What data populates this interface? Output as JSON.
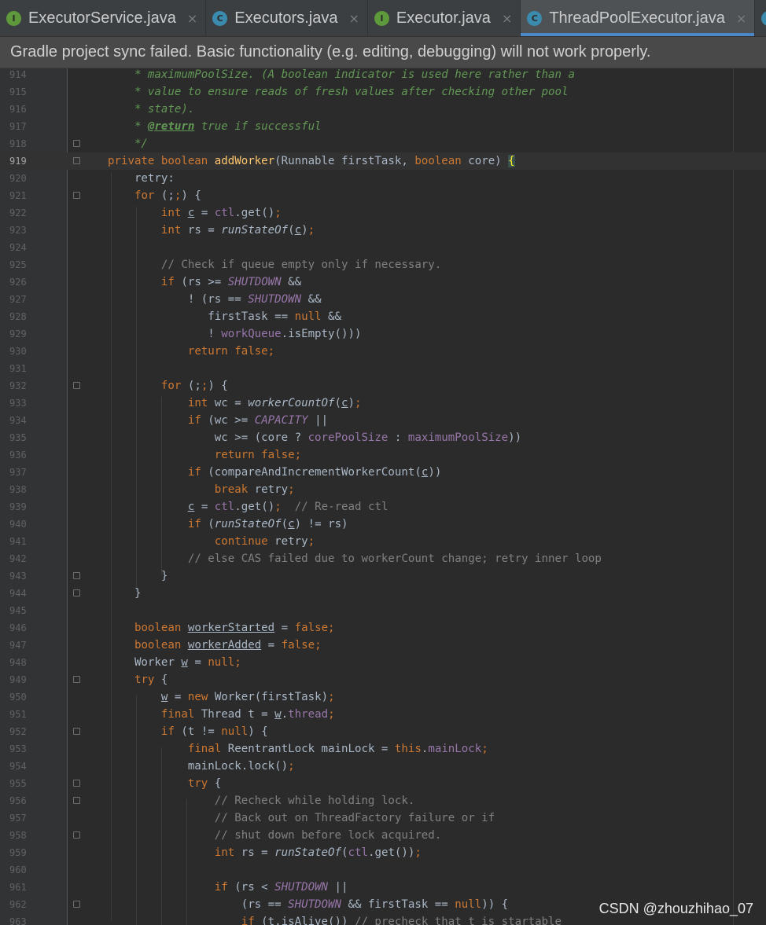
{
  "tabs": [
    {
      "label": "ExecutorService.java",
      "kind": "interface",
      "icon": "interface-icon",
      "icon_letter": "I",
      "close": "×",
      "active": false
    },
    {
      "label": "Executors.java",
      "kind": "class",
      "icon": "class-icon",
      "icon_letter": "C",
      "close": "×",
      "active": false
    },
    {
      "label": "Executor.java",
      "kind": "interface",
      "icon": "interface-icon",
      "icon_letter": "I",
      "close": "×",
      "active": false
    },
    {
      "label": "ThreadPoolExecutor.java",
      "kind": "class",
      "icon": "class-icon",
      "icon_letter": "C",
      "close": "×",
      "active": true
    },
    {
      "label": "At",
      "kind": "class",
      "icon": "class-icon",
      "icon_letter": "C",
      "close": "",
      "active": false
    }
  ],
  "banner": {
    "message": "Gradle project sync failed. Basic functionality (e.g. editing, debugging) will not work properly."
  },
  "editor": {
    "current_line": 919,
    "lines": [
      {
        "n": 914,
        "fold": false,
        "segs": [
          [
            "dc",
            "    * maximumPoolSize. (A boolean indicator is used here rather than a"
          ]
        ]
      },
      {
        "n": 915,
        "fold": false,
        "segs": [
          [
            "dc",
            "    * value to ensure reads of fresh values after checking other pool"
          ]
        ]
      },
      {
        "n": 916,
        "fold": false,
        "segs": [
          [
            "dc",
            "    * state)."
          ]
        ]
      },
      {
        "n": 917,
        "fold": false,
        "segs": [
          [
            "dc",
            "    * "
          ],
          [
            "tag",
            "@return"
          ],
          [
            "dc",
            " true if successful"
          ]
        ]
      },
      {
        "n": 918,
        "fold": true,
        "segs": [
          [
            "dc",
            "    */"
          ]
        ]
      },
      {
        "n": 919,
        "fold": true,
        "segs": [
          [
            "k",
            "private boolean "
          ],
          [
            "fn",
            "addWorker"
          ],
          [
            "p",
            "(Runnable firstTask, "
          ],
          [
            "k",
            "boolean "
          ],
          [
            "p",
            "core) "
          ],
          [
            "br",
            "{"
          ]
        ]
      },
      {
        "n": 920,
        "fold": false,
        "segs": [
          [
            "p",
            "    retry:"
          ]
        ]
      },
      {
        "n": 921,
        "fold": true,
        "segs": [
          [
            "p",
            "    "
          ],
          [
            "k",
            "for "
          ],
          [
            "p",
            "(;"
          ],
          [
            "k",
            ";"
          ],
          [
            "p",
            ") {"
          ]
        ]
      },
      {
        "n": 922,
        "fold": false,
        "segs": [
          [
            "p",
            "        "
          ],
          [
            "k",
            "int "
          ],
          [
            "u",
            "c"
          ],
          [
            "p",
            " = "
          ],
          [
            "fi",
            "ctl"
          ],
          [
            "p",
            ".get()"
          ],
          [
            "k",
            ";"
          ]
        ]
      },
      {
        "n": 923,
        "fold": false,
        "segs": [
          [
            "p",
            "        "
          ],
          [
            "k",
            "int "
          ],
          [
            "p",
            "rs = "
          ],
          [
            "sm",
            "runStateOf"
          ],
          [
            "p",
            "("
          ],
          [
            "u",
            "c"
          ],
          [
            "p",
            ")"
          ],
          [
            "k",
            ";"
          ]
        ]
      },
      {
        "n": 924,
        "fold": false,
        "segs": []
      },
      {
        "n": 925,
        "fold": false,
        "segs": [
          [
            "p",
            "        "
          ],
          [
            "cm",
            "// Check if queue empty only if necessary."
          ]
        ]
      },
      {
        "n": 926,
        "fold": false,
        "segs": [
          [
            "p",
            "        "
          ],
          [
            "k",
            "if "
          ],
          [
            "p",
            "(rs >= "
          ],
          [
            "st",
            "SHUTDOWN"
          ],
          [
            "p",
            " &&"
          ]
        ]
      },
      {
        "n": 927,
        "fold": false,
        "segs": [
          [
            "p",
            "            ! (rs == "
          ],
          [
            "st",
            "SHUTDOWN"
          ],
          [
            "p",
            " &&"
          ]
        ]
      },
      {
        "n": 928,
        "fold": false,
        "segs": [
          [
            "p",
            "               firstTask == "
          ],
          [
            "k",
            "null "
          ],
          [
            "p",
            "&&"
          ]
        ]
      },
      {
        "n": 929,
        "fold": false,
        "segs": [
          [
            "p",
            "               ! "
          ],
          [
            "fi",
            "workQueue"
          ],
          [
            "p",
            ".isEmpty()))"
          ]
        ]
      },
      {
        "n": 930,
        "fold": false,
        "segs": [
          [
            "p",
            "            "
          ],
          [
            "k",
            "return false;"
          ]
        ]
      },
      {
        "n": 931,
        "fold": false,
        "segs": []
      },
      {
        "n": 932,
        "fold": true,
        "segs": [
          [
            "p",
            "        "
          ],
          [
            "k",
            "for "
          ],
          [
            "p",
            "(;"
          ],
          [
            "k",
            ";"
          ],
          [
            "p",
            ") {"
          ]
        ]
      },
      {
        "n": 933,
        "fold": false,
        "segs": [
          [
            "p",
            "            "
          ],
          [
            "k",
            "int "
          ],
          [
            "p",
            "wc = "
          ],
          [
            "sm",
            "workerCountOf"
          ],
          [
            "p",
            "("
          ],
          [
            "u",
            "c"
          ],
          [
            "p",
            ")"
          ],
          [
            "k",
            ";"
          ]
        ]
      },
      {
        "n": 934,
        "fold": false,
        "segs": [
          [
            "p",
            "            "
          ],
          [
            "k",
            "if "
          ],
          [
            "p",
            "(wc >= "
          ],
          [
            "st",
            "CAPACITY"
          ],
          [
            "p",
            " ||"
          ]
        ]
      },
      {
        "n": 935,
        "fold": false,
        "segs": [
          [
            "p",
            "                wc >= (core ? "
          ],
          [
            "fi",
            "corePoolSize"
          ],
          [
            "p",
            " : "
          ],
          [
            "fi",
            "maximumPoolSize"
          ],
          [
            "p",
            "))"
          ]
        ]
      },
      {
        "n": 936,
        "fold": false,
        "segs": [
          [
            "p",
            "                "
          ],
          [
            "k",
            "return false;"
          ]
        ]
      },
      {
        "n": 937,
        "fold": false,
        "segs": [
          [
            "p",
            "            "
          ],
          [
            "k",
            "if "
          ],
          [
            "p",
            "(compareAndIncrementWorkerCount("
          ],
          [
            "u",
            "c"
          ],
          [
            "p",
            "))"
          ]
        ]
      },
      {
        "n": 938,
        "fold": false,
        "segs": [
          [
            "p",
            "                "
          ],
          [
            "k",
            "break "
          ],
          [
            "p",
            "retry"
          ],
          [
            "k",
            ";"
          ]
        ]
      },
      {
        "n": 939,
        "fold": false,
        "segs": [
          [
            "p",
            "            "
          ],
          [
            "u",
            "c"
          ],
          [
            "p",
            " = "
          ],
          [
            "fi",
            "ctl"
          ],
          [
            "p",
            ".get()"
          ],
          [
            "k",
            ";  "
          ],
          [
            "cm",
            "// Re-read ctl"
          ]
        ]
      },
      {
        "n": 940,
        "fold": false,
        "segs": [
          [
            "p",
            "            "
          ],
          [
            "k",
            "if "
          ],
          [
            "p",
            "("
          ],
          [
            "sm",
            "runStateOf"
          ],
          [
            "p",
            "("
          ],
          [
            "u",
            "c"
          ],
          [
            "p",
            ") != rs)"
          ]
        ]
      },
      {
        "n": 941,
        "fold": false,
        "segs": [
          [
            "p",
            "                "
          ],
          [
            "k",
            "continue "
          ],
          [
            "p",
            "retry"
          ],
          [
            "k",
            ";"
          ]
        ]
      },
      {
        "n": 942,
        "fold": false,
        "segs": [
          [
            "p",
            "            "
          ],
          [
            "cm",
            "// else CAS failed due to workerCount change; retry inner loop"
          ]
        ]
      },
      {
        "n": 943,
        "fold": true,
        "segs": [
          [
            "p",
            "        }"
          ]
        ]
      },
      {
        "n": 944,
        "fold": true,
        "segs": [
          [
            "p",
            "    }"
          ]
        ]
      },
      {
        "n": 945,
        "fold": false,
        "segs": []
      },
      {
        "n": 946,
        "fold": false,
        "segs": [
          [
            "p",
            "    "
          ],
          [
            "k",
            "boolean "
          ],
          [
            "u",
            "workerStarted"
          ],
          [
            "p",
            " = "
          ],
          [
            "k",
            "false;"
          ]
        ]
      },
      {
        "n": 947,
        "fold": false,
        "segs": [
          [
            "p",
            "    "
          ],
          [
            "k",
            "boolean "
          ],
          [
            "u",
            "workerAdded"
          ],
          [
            "p",
            " = "
          ],
          [
            "k",
            "false;"
          ]
        ]
      },
      {
        "n": 948,
        "fold": false,
        "segs": [
          [
            "p",
            "    Worker "
          ],
          [
            "u",
            "w"
          ],
          [
            "p",
            " = "
          ],
          [
            "k",
            "null;"
          ]
        ]
      },
      {
        "n": 949,
        "fold": true,
        "segs": [
          [
            "p",
            "    "
          ],
          [
            "k",
            "try "
          ],
          [
            "p",
            "{"
          ]
        ]
      },
      {
        "n": 950,
        "fold": false,
        "segs": [
          [
            "p",
            "        "
          ],
          [
            "u",
            "w"
          ],
          [
            "p",
            " = "
          ],
          [
            "k",
            "new "
          ],
          [
            "p",
            "Worker(firstTask)"
          ],
          [
            "k",
            ";"
          ]
        ]
      },
      {
        "n": 951,
        "fold": false,
        "segs": [
          [
            "p",
            "        "
          ],
          [
            "k",
            "final "
          ],
          [
            "p",
            "Thread t = "
          ],
          [
            "u",
            "w"
          ],
          [
            "p",
            "."
          ],
          [
            "fi",
            "thread"
          ],
          [
            "k",
            ";"
          ]
        ]
      },
      {
        "n": 952,
        "fold": true,
        "segs": [
          [
            "p",
            "        "
          ],
          [
            "k",
            "if "
          ],
          [
            "p",
            "(t != "
          ],
          [
            "k",
            "null"
          ],
          [
            "p",
            ") {"
          ]
        ]
      },
      {
        "n": 953,
        "fold": false,
        "segs": [
          [
            "p",
            "            "
          ],
          [
            "k",
            "final "
          ],
          [
            "p",
            "ReentrantLock mainLock = "
          ],
          [
            "k",
            "this"
          ],
          [
            "p",
            "."
          ],
          [
            "fi",
            "mainLock"
          ],
          [
            "k",
            ";"
          ]
        ]
      },
      {
        "n": 954,
        "fold": false,
        "segs": [
          [
            "p",
            "            mainLock.lock()"
          ],
          [
            "k",
            ";"
          ]
        ]
      },
      {
        "n": 955,
        "fold": true,
        "segs": [
          [
            "p",
            "            "
          ],
          [
            "k",
            "try "
          ],
          [
            "p",
            "{"
          ]
        ]
      },
      {
        "n": 956,
        "fold": true,
        "segs": [
          [
            "p",
            "                "
          ],
          [
            "cm",
            "// Recheck while holding lock."
          ]
        ]
      },
      {
        "n": 957,
        "fold": false,
        "segs": [
          [
            "p",
            "                "
          ],
          [
            "cm",
            "// Back out on ThreadFactory failure or if"
          ]
        ]
      },
      {
        "n": 958,
        "fold": true,
        "segs": [
          [
            "p",
            "                "
          ],
          [
            "cm",
            "// shut down before lock acquired."
          ]
        ]
      },
      {
        "n": 959,
        "fold": false,
        "segs": [
          [
            "p",
            "                "
          ],
          [
            "k",
            "int "
          ],
          [
            "p",
            "rs = "
          ],
          [
            "sm",
            "runStateOf"
          ],
          [
            "p",
            "("
          ],
          [
            "fi",
            "ctl"
          ],
          [
            "p",
            ".get())"
          ],
          [
            "k",
            ";"
          ]
        ]
      },
      {
        "n": 960,
        "fold": false,
        "segs": []
      },
      {
        "n": 961,
        "fold": false,
        "segs": [
          [
            "p",
            "                "
          ],
          [
            "k",
            "if "
          ],
          [
            "p",
            "(rs < "
          ],
          [
            "st",
            "SHUTDOWN"
          ],
          [
            "p",
            " ||"
          ]
        ]
      },
      {
        "n": 962,
        "fold": true,
        "segs": [
          [
            "p",
            "                    (rs == "
          ],
          [
            "st",
            "SHUTDOWN"
          ],
          [
            "p",
            " && firstTask == "
          ],
          [
            "k",
            "null"
          ],
          [
            "p",
            ")) {"
          ]
        ]
      },
      {
        "n": 963,
        "fold": false,
        "segs": [
          [
            "p",
            "                    "
          ],
          [
            "k",
            "if "
          ],
          [
            "p",
            "(t.isAlive()) "
          ],
          [
            "cm",
            "// precheck that t is startable"
          ]
        ]
      }
    ]
  },
  "watermark": {
    "text": "CSDN @zhouzhihao_07"
  }
}
